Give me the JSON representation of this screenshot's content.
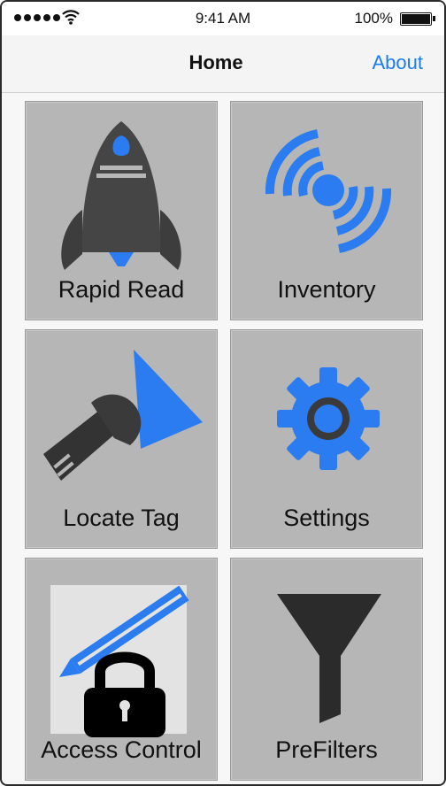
{
  "status": {
    "time": "9:41 AM",
    "battery": "100%"
  },
  "nav": {
    "title": "Home",
    "about_label": "About"
  },
  "tiles": [
    {
      "label": "Rapid Read",
      "icon": "rocket-icon"
    },
    {
      "label": "Inventory",
      "icon": "wireless-signal-icon"
    },
    {
      "label": "Locate Tag",
      "icon": "flashlight-icon"
    },
    {
      "label": "Settings",
      "icon": "gear-icon"
    },
    {
      "label": "Access Control",
      "icon": "pencil-lock-icon"
    },
    {
      "label": "PreFilters",
      "icon": "funnel-icon"
    }
  ],
  "colors": {
    "accent": "#2a7cf0",
    "tile": "#b6b6b6",
    "icon_dark": "#3a3a3a",
    "link": "#1a7cf0"
  }
}
